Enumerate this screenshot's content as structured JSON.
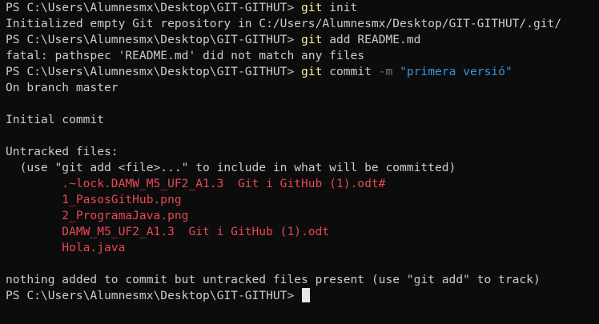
{
  "terminal": {
    "prompt": "PS C:\\Users\\Alumnesmx\\Desktop\\GIT-GITHUT>",
    "lines": [
      {
        "kind": "command",
        "cmd": "git",
        "args": "init",
        "flag": "",
        "string": ""
      },
      {
        "kind": "output",
        "text": "Initialized empty Git repository in C:/Users/Alumnesmx/Desktop/GIT-GITHUT/.git/"
      },
      {
        "kind": "command",
        "cmd": "git",
        "args": "add README.md",
        "flag": "",
        "string": ""
      },
      {
        "kind": "output",
        "text": "fatal: pathspec 'README.md' did not match any files"
      },
      {
        "kind": "command",
        "cmd": "git",
        "args": "commit",
        "flag": "-m",
        "string": "\"primera versió\""
      },
      {
        "kind": "output",
        "text": "On branch master"
      },
      {
        "kind": "output",
        "text": ""
      },
      {
        "kind": "output",
        "text": "Initial commit"
      },
      {
        "kind": "output",
        "text": ""
      },
      {
        "kind": "output",
        "text": "Untracked files:"
      },
      {
        "kind": "output",
        "text": "  (use \"git add <file>...\" to include in what will be committed)"
      },
      {
        "kind": "untracked",
        "text": "        .~lock.DAMW_M5_UF2_A1.3  Git i GitHub (1).odt#"
      },
      {
        "kind": "untracked",
        "text": "        1_PasosGitHub.png"
      },
      {
        "kind": "untracked",
        "text": "        2_ProgramaJava.png"
      },
      {
        "kind": "untracked",
        "text": "        DAMW_M5_UF2_A1.3  Git i GitHub (1).odt"
      },
      {
        "kind": "untracked",
        "text": "        Hola.java"
      },
      {
        "kind": "output",
        "text": ""
      },
      {
        "kind": "output",
        "text": "nothing added to commit but untracked files present (use \"git add\" to track)"
      },
      {
        "kind": "prompt_only"
      }
    ]
  },
  "colors": {
    "background": "#0c0c0c",
    "foreground": "#cccccc",
    "command": "#f9f1a5",
    "parameter": "#767676",
    "string": "#3a96dd",
    "untracked": "#e74856"
  }
}
